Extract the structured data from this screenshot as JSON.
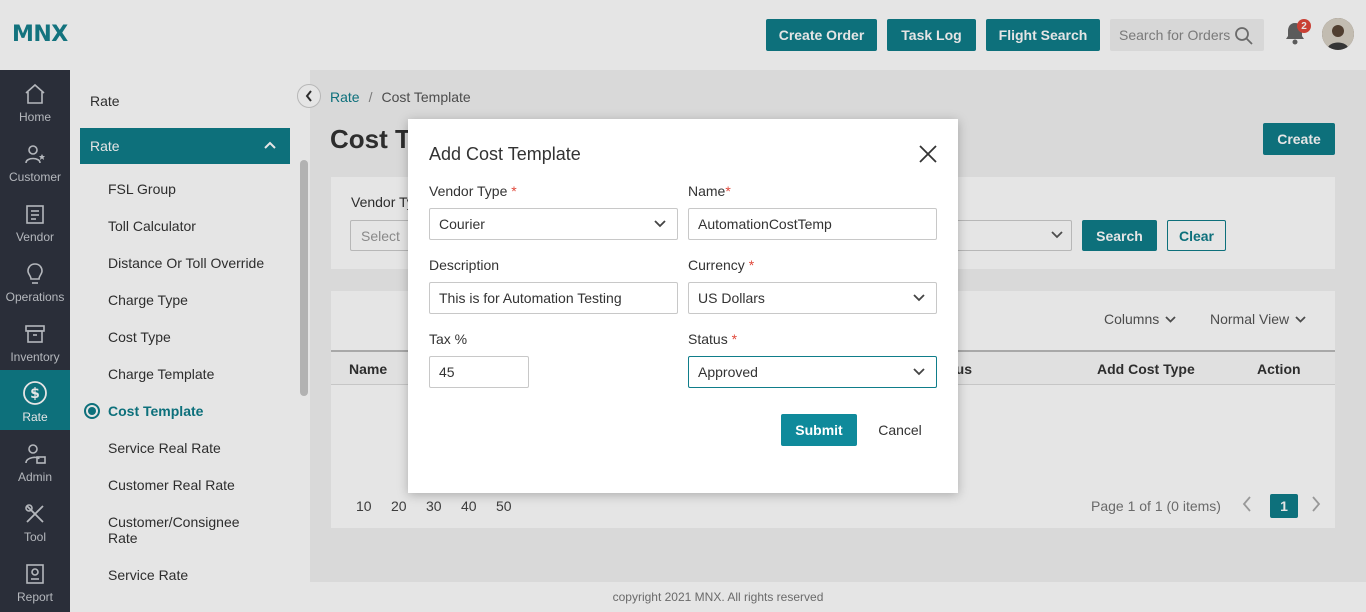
{
  "app": {
    "logo": "MNX"
  },
  "header": {
    "create_order": "Create Order",
    "task_log": "Task Log",
    "flight_search": "Flight Search",
    "search_placeholder": "Search for Orders",
    "notification_count": "2"
  },
  "leftnav": {
    "items": [
      {
        "label": "Home",
        "icon": "home-icon"
      },
      {
        "label": "Customer",
        "icon": "customer-icon"
      },
      {
        "label": "Vendor",
        "icon": "vendor-icon"
      },
      {
        "label": "Operations",
        "icon": "bulb-icon"
      },
      {
        "label": "Inventory",
        "icon": "inventory-icon"
      },
      {
        "label": "Rate",
        "icon": "dollar-icon",
        "active": true
      },
      {
        "label": "Admin",
        "icon": "admin-icon"
      },
      {
        "label": "Tool",
        "icon": "tool-icon"
      },
      {
        "label": "Report",
        "icon": "report-icon"
      }
    ]
  },
  "subnav": {
    "title": "Rate",
    "section": "Rate",
    "items": [
      "FSL Group",
      "Toll Calculator",
      "Distance Or Toll Override",
      "Charge Type",
      "Cost Type",
      "Charge Template",
      "Cost Template",
      "Service Real Rate",
      "Customer Real Rate",
      "Customer/Consignee Rate",
      "Service Rate"
    ],
    "active_item": "Cost Template"
  },
  "breadcrumb": {
    "parent": "Rate",
    "separator": "/",
    "current": "Cost Template"
  },
  "page": {
    "title": "Cost Te",
    "create_label": "Create"
  },
  "filter": {
    "label": "Vendor Ty",
    "select_placeholder": "Select",
    "search_label": "Search",
    "clear_label": "Clear"
  },
  "table": {
    "columns_label": "Columns",
    "view_label": "Normal View",
    "headers": {
      "name": "Name",
      "status": "tus",
      "add_cost_type": "Add Cost Type",
      "action": "Action"
    },
    "page_sizes": [
      "10",
      "20",
      "30",
      "40",
      "50"
    ],
    "pager_info": "Page 1 of 1 (0 items)",
    "current_page": "1"
  },
  "footer": {
    "text": "copyright 2021 MNX. All rights reserved"
  },
  "modal": {
    "title": "Add Cost Template",
    "vendor_type_label": "Vendor Type",
    "vendor_type_value": "Courier",
    "name_label": "Name",
    "name_value": "AutomationCostTemp",
    "description_label": "Description",
    "description_value": "This is for Automation Testing",
    "currency_label": "Currency",
    "currency_value": "US Dollars",
    "tax_label": "Tax %",
    "tax_value": "45",
    "status_label": "Status",
    "status_value": "Approved",
    "required_mark": "*",
    "submit_label": "Submit",
    "cancel_label": "Cancel"
  },
  "colors": {
    "primary": "#0f7d8a",
    "required": "#e0483b",
    "nav_bg": "#2f3440"
  }
}
